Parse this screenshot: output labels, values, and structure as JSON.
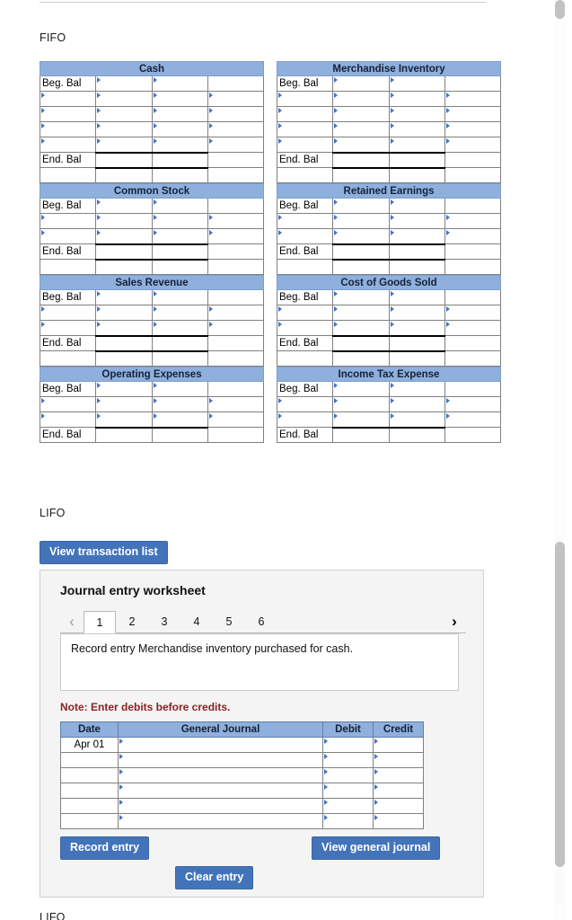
{
  "sections": {
    "fifo_label": "FIFO",
    "lifo_label": "LIFO",
    "lifo_bottom_label": "LIFO"
  },
  "colors": {
    "header_blue": "#8fb0dc",
    "button_blue": "#4374b9",
    "note_red": "#8a2222",
    "marker_blue": "#4472c4"
  },
  "t_accounts": {
    "row_labels": {
      "beginning": "Beg. Bal",
      "ending": "End. Bal"
    },
    "groups": [
      {
        "title": "Cash",
        "data_rows": 4,
        "has_tail_row": true
      },
      {
        "title": "Merchandise Inventory",
        "data_rows": 4,
        "has_tail_row": true
      },
      {
        "title": "Common Stock",
        "data_rows": 2,
        "has_tail_row": true
      },
      {
        "title": "Retained Earnings",
        "data_rows": 2,
        "has_tail_row": true
      },
      {
        "title": "Sales Revenue",
        "data_rows": 2,
        "has_tail_row": true
      },
      {
        "title": "Cost of Goods Sold",
        "data_rows": 2,
        "has_tail_row": true
      },
      {
        "title": "Operating Expenses",
        "data_rows": 2,
        "has_tail_row": false
      },
      {
        "title": "Income Tax Expense",
        "data_rows": 2,
        "has_tail_row": false
      }
    ]
  },
  "toolbar": {
    "view_transaction_list_label": "View transaction list"
  },
  "journal_panel": {
    "title": "Journal entry worksheet",
    "prev_icon": "chevron-left",
    "next_icon": "chevron-right",
    "tabs": [
      "1",
      "2",
      "3",
      "4",
      "5",
      "6"
    ],
    "active_tab": "1",
    "entry_description": "Record entry Merchandise inventory purchased for cash.",
    "note": "Note: Enter debits before credits.",
    "table": {
      "columns": [
        "Date",
        "General Journal",
        "Debit",
        "Credit"
      ],
      "rows": [
        {
          "date": "Apr 01",
          "general_journal": "",
          "debit": "",
          "credit": ""
        },
        {
          "date": "",
          "general_journal": "",
          "debit": "",
          "credit": ""
        },
        {
          "date": "",
          "general_journal": "",
          "debit": "",
          "credit": ""
        },
        {
          "date": "",
          "general_journal": "",
          "debit": "",
          "credit": ""
        },
        {
          "date": "",
          "general_journal": "",
          "debit": "",
          "credit": ""
        },
        {
          "date": "",
          "general_journal": "",
          "debit": "",
          "credit": ""
        }
      ]
    },
    "buttons": {
      "record_entry": "Record entry",
      "clear_entry": "Clear entry",
      "view_general_journal": "View general journal"
    }
  }
}
